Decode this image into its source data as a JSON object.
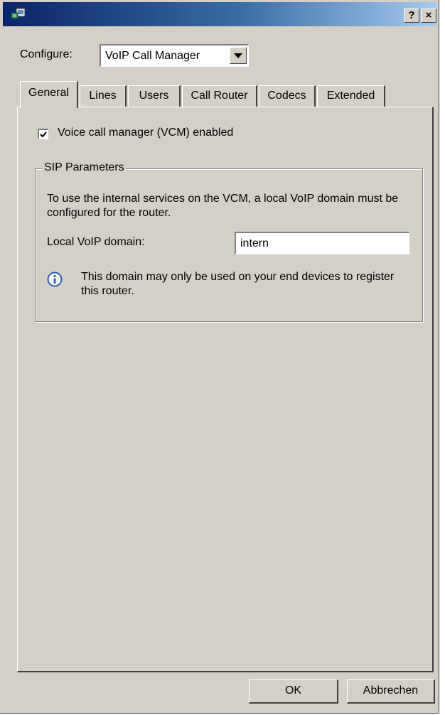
{
  "window": {
    "help_button": "?",
    "close_button": "×"
  },
  "configure": {
    "label": "Configure:",
    "selected": "VoIP Call Manager"
  },
  "tabs": [
    {
      "label": "General",
      "active": true
    },
    {
      "label": "Lines",
      "active": false
    },
    {
      "label": "Users",
      "active": false
    },
    {
      "label": "Call Router",
      "active": false
    },
    {
      "label": "Codecs",
      "active": false
    },
    {
      "label": "Extended",
      "active": false
    }
  ],
  "general": {
    "vcm_enabled_label": "Voice call manager (VCM) enabled",
    "vcm_enabled_checked": true,
    "sip": {
      "legend": "SIP Parameters",
      "description": "To use the internal services on the VCM, a local VoIP domain must be configured for the router.",
      "domain_label": "Local VoIP domain:",
      "domain_value": "intern",
      "info_text": "This domain may only be used on your end devices to register this router."
    }
  },
  "buttons": {
    "ok": "OK",
    "cancel": "Abbrechen"
  },
  "colors": {
    "dialog_bg": "#d4d0c8",
    "title_start": "#0a246a",
    "title_end": "#a6caf0"
  }
}
